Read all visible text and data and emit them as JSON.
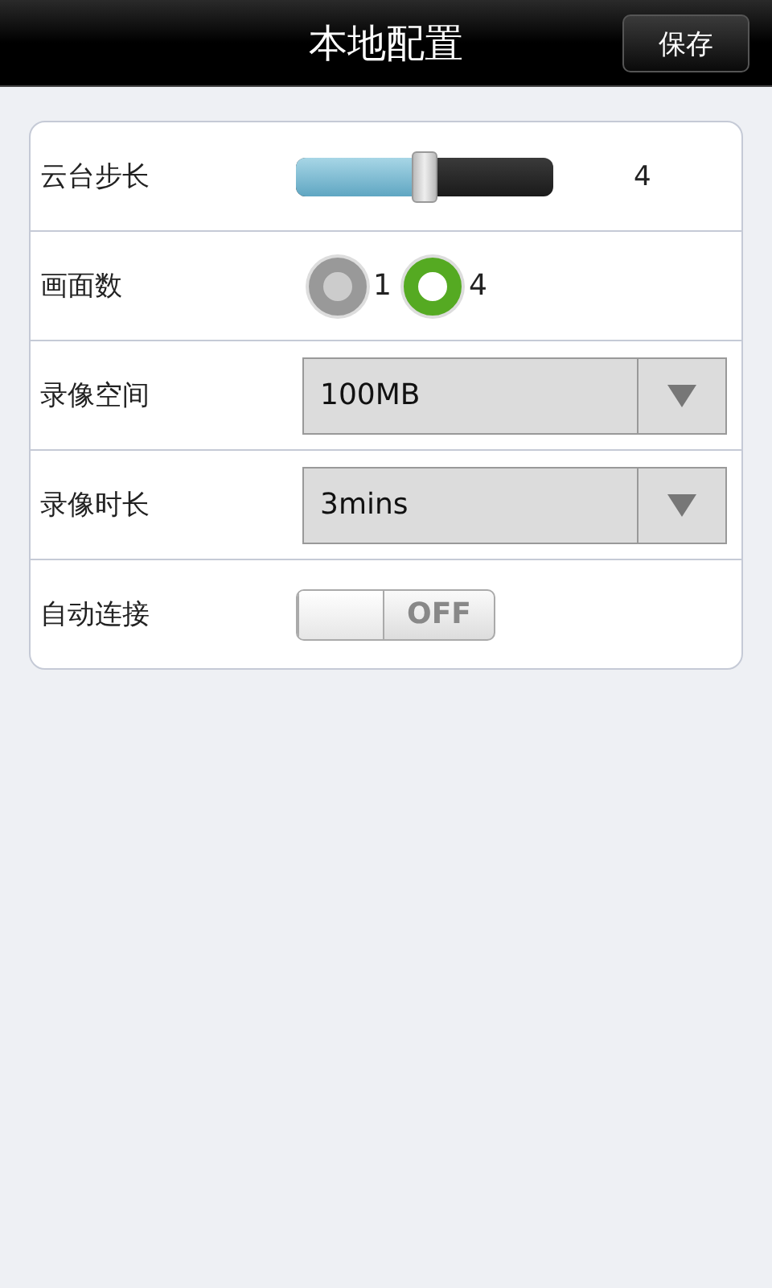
{
  "header": {
    "title": "本地配置",
    "save_button": "保存"
  },
  "rows": [
    {
      "kind": "slider",
      "label": "云台步长",
      "level": 0.5,
      "reading": "4"
    },
    {
      "kind": "radio",
      "label": "画面数",
      "options": [
        {
          "label": "1",
          "selected": false
        },
        {
          "label": "4",
          "selected": true
        }
      ]
    },
    {
      "kind": "dropdown",
      "label": "录像空间",
      "value": "100MB"
    },
    {
      "kind": "dropdown",
      "label": "录像时长",
      "value": "3mins"
    },
    {
      "kind": "toggle",
      "label": "自动连接",
      "on": false,
      "state_label": "OFF"
    }
  ]
}
